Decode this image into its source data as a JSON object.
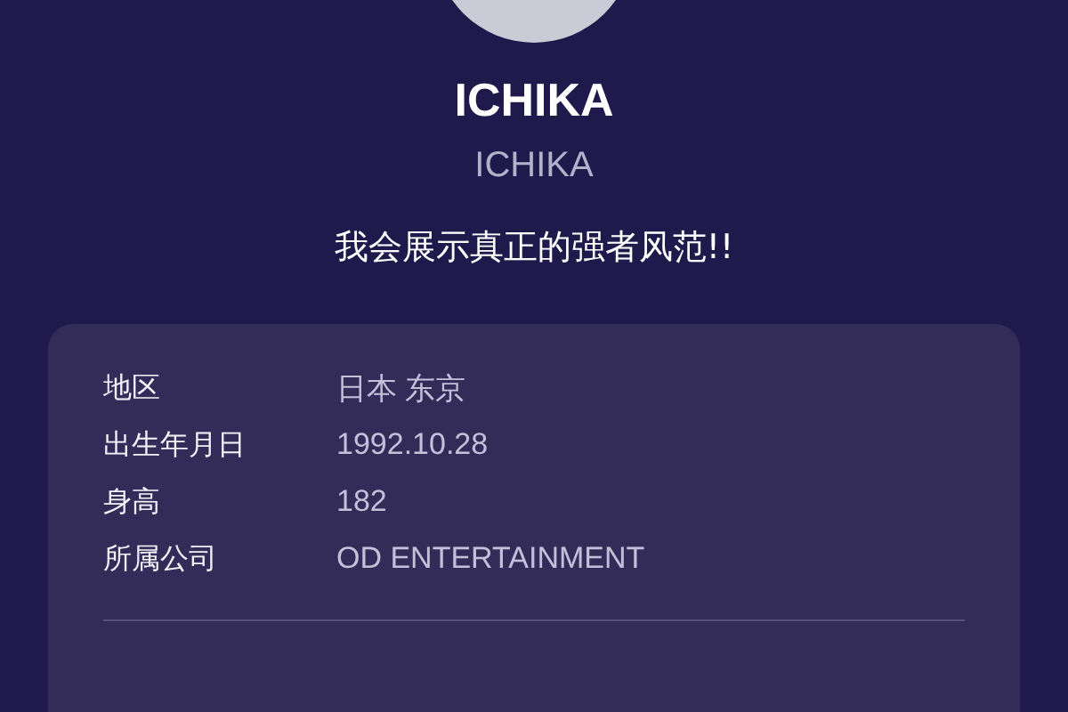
{
  "profile": {
    "name": "ICHIKA",
    "subtitle": "ICHIKA",
    "motto": "我会展示真正的强者风范!!"
  },
  "info": [
    {
      "label": "地区",
      "value": "日本 东京"
    },
    {
      "label": "出生年月日",
      "value": "1992.10.28"
    },
    {
      "label": "身高",
      "value": "182"
    },
    {
      "label": "所属公司",
      "value": "OD ENTERTAINMENT"
    }
  ]
}
